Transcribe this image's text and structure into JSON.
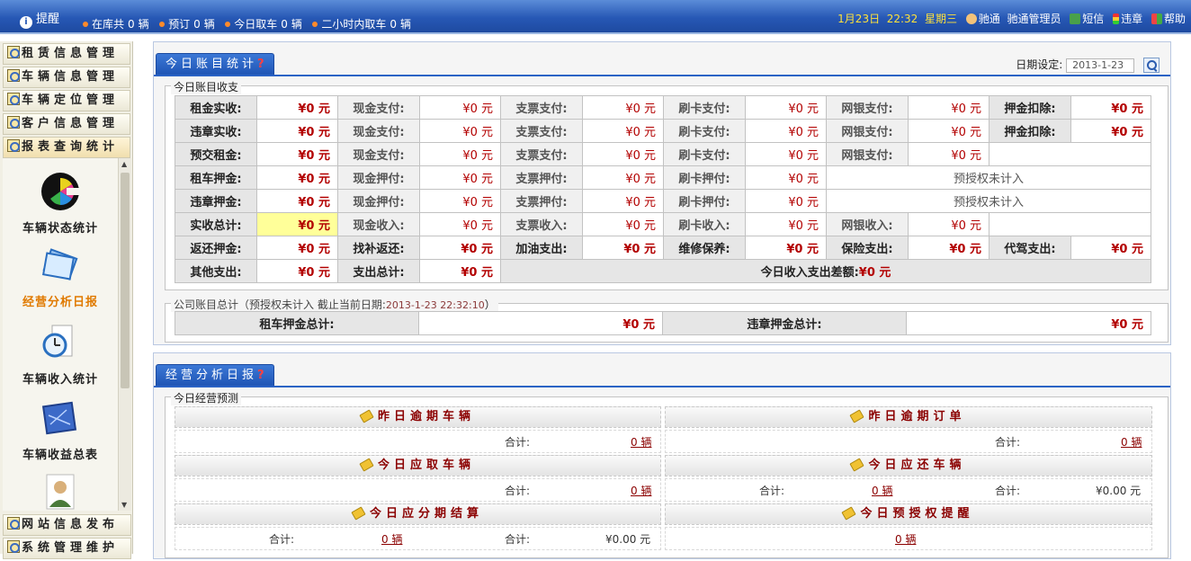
{
  "topbar": {
    "alert_label": "提醒",
    "stats": [
      {
        "label": "在库共",
        "value": "0",
        "unit": "辆"
      },
      {
        "label": "预订",
        "value": "0",
        "unit": "辆"
      },
      {
        "label": "今日取车",
        "value": "0",
        "unit": "辆"
      },
      {
        "label": "二小时内取车",
        "value": "0",
        "unit": "辆"
      }
    ],
    "date": "1月23日",
    "time": "22:32",
    "weekday": "星期三",
    "company": "驰通",
    "user": "驰通管理员",
    "sms": "短信",
    "violation": "违章",
    "help": "帮助"
  },
  "sidebar": {
    "menu": [
      {
        "label": "租赁信息管理"
      },
      {
        "label": "车辆信息管理"
      },
      {
        "label": "车辆定位管理"
      },
      {
        "label": "客户信息管理"
      },
      {
        "label": "报表查询统计"
      }
    ],
    "launch": [
      {
        "label": "车辆状态统计"
      },
      {
        "label": "经营分析日报"
      },
      {
        "label": "车辆收入统计"
      },
      {
        "label": "车辆收益总表"
      }
    ],
    "bottom": [
      {
        "label": "网站信息发布"
      },
      {
        "label": "系统管理维护"
      }
    ]
  },
  "account": {
    "tab_label": "今日账目统计",
    "tab_help": "?",
    "date_label": "日期设定:",
    "date_value": "2013-1-23",
    "section1_title": "今日账目收支",
    "rows": [
      [
        [
          "租金实收:",
          "¥0 元"
        ],
        [
          "现金支付:",
          "¥0 元"
        ],
        [
          "支票支付:",
          "¥0 元"
        ],
        [
          "刷卡支付:",
          "¥0 元"
        ],
        [
          "网银支付:",
          "¥0 元"
        ],
        [
          "押金扣除:",
          "¥0 元"
        ]
      ],
      [
        [
          "违章实收:",
          "¥0 元"
        ],
        [
          "现金支付:",
          "¥0 元"
        ],
        [
          "支票支付:",
          "¥0 元"
        ],
        [
          "刷卡支付:",
          "¥0 元"
        ],
        [
          "网银支付:",
          "¥0 元"
        ],
        [
          "押金扣除:",
          "¥0 元"
        ]
      ],
      [
        [
          "预交租金:",
          "¥0 元"
        ],
        [
          "现金支付:",
          "¥0 元"
        ],
        [
          "支票支付:",
          "¥0 元"
        ],
        [
          "刷卡支付:",
          "¥0 元"
        ],
        [
          "网银支付:",
          "¥0 元"
        ]
      ],
      [
        [
          "租车押金:",
          "¥0 元"
        ],
        [
          "现金押付:",
          "¥0 元"
        ],
        [
          "支票押付:",
          "¥0 元"
        ],
        [
          "刷卡押付:",
          "¥0 元"
        ]
      ],
      [
        [
          "违章押金:",
          "¥0 元"
        ],
        [
          "现金押付:",
          "¥0 元"
        ],
        [
          "支票押付:",
          "¥0 元"
        ],
        [
          "刷卡押付:",
          "¥0 元"
        ]
      ],
      [
        [
          "实收总计:",
          "¥0 元"
        ],
        [
          "现金收入:",
          "¥0 元"
        ],
        [
          "支票收入:",
          "¥0 元"
        ],
        [
          "刷卡收入:",
          "¥0 元"
        ],
        [
          "网银收入:",
          "¥0 元"
        ]
      ],
      [
        [
          "返还押金:",
          "¥0 元"
        ],
        [
          "找补返还:",
          "¥0 元"
        ],
        [
          "加油支出:",
          "¥0 元"
        ],
        [
          "维修保养:",
          "¥0 元"
        ],
        [
          "保险支出:",
          "¥0 元"
        ],
        [
          "代驾支出:",
          "¥0 元"
        ]
      ],
      [
        [
          "其他支出:",
          "¥0 元"
        ],
        [
          "支出总计:",
          "¥0 元"
        ]
      ]
    ],
    "preauth_note": "预授权未计入",
    "diff_label": "今日收入支出差额:",
    "diff_value": "¥0 元",
    "section2_title": "公司账目总计（预授权未计入 截止当前日期:",
    "section2_date": "2013-1-23 22:32:10",
    "section2_close": "）",
    "company_totals": [
      {
        "label": "租车押金总计:",
        "value": "¥0 元"
      },
      {
        "label": "违章押金总计:",
        "value": "¥0 元"
      }
    ]
  },
  "ops": {
    "tab_label": "经营分析日报",
    "tab_help": "?",
    "section_title": "今日经营预测",
    "blocks": {
      "overdue_vehicles": {
        "title": "昨日逾期车辆",
        "total_label": "合计:",
        "total": "0 辆"
      },
      "overdue_orders": {
        "title": "昨日逾期订单",
        "total_label": "合计:",
        "total": "0 辆"
      },
      "pickup_today": {
        "title": "今日应取车辆",
        "total_label": "合计:",
        "total": "0 辆"
      },
      "return_today": {
        "title": "今日应还车辆",
        "count_label": "合计:",
        "count": "0 辆",
        "amount_label": "合计:",
        "amount": "¥0.00 元"
      },
      "installment": {
        "title": "今日应分期结算",
        "count_label": "合计:",
        "count": "0 辆",
        "amount_label": "合计:",
        "amount": "¥0.00 元"
      },
      "preauth": {
        "title": "今日预授权提醒",
        "total": "0 辆"
      }
    }
  }
}
